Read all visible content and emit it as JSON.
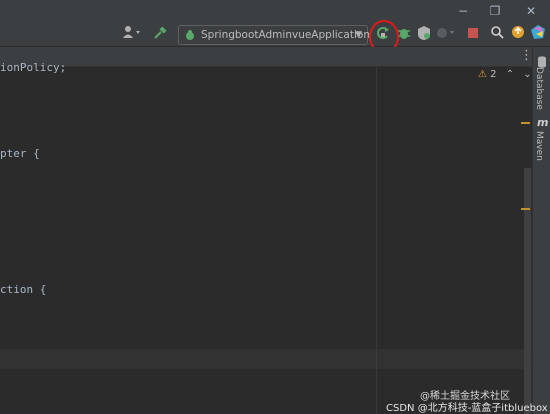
{
  "window": {
    "minimize_glyph": "−",
    "restore_glyph": "❐",
    "close_glyph": "✕"
  },
  "toolbar": {
    "run_config_label": "SpringbootAdminvueApplication",
    "more_glyph": "⋮"
  },
  "editor": {
    "code_lines": [
      "ionPolicy;",
      "pter {",
      "ction {"
    ],
    "inspection_count": "2",
    "inspection_glyph": "⚠"
  },
  "right_strip": {
    "database_label": "Database",
    "maven_label": "Maven",
    "maven_glyph": "m"
  },
  "watermark": {
    "line1": "@稀土掘金技术社区",
    "line2": "CSDN @北方科技-蓝盒子itbluebox"
  },
  "colors": {
    "accent_run": "#59a869",
    "highlight_annotation": "#e01a1a",
    "stop": "#c75450",
    "warning": "#c8902b"
  }
}
